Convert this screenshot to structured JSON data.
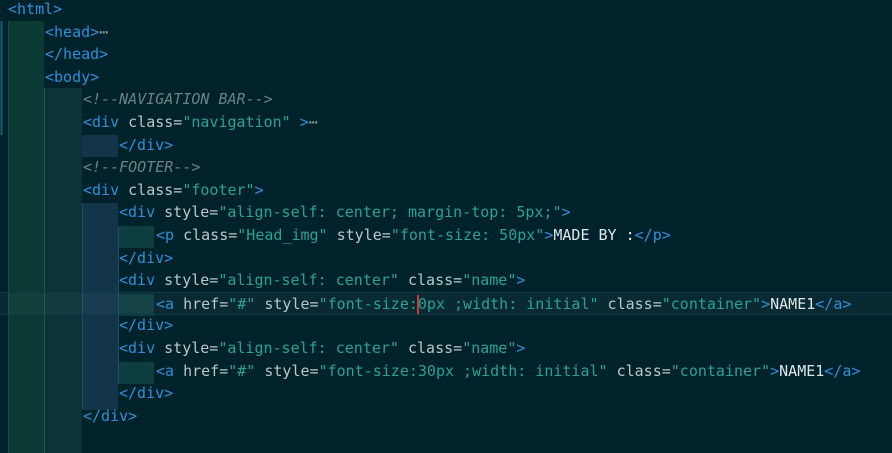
{
  "editor": {
    "colors": {
      "background": "#00232b",
      "tag": "#2d8fd8",
      "attribute": "#b9c7c7",
      "string": "#2aa198",
      "text": "#dde6e6",
      "comment": "#6c8184",
      "cursor": "#d0362f"
    },
    "lines": [
      {
        "indent": 0,
        "tokens": [
          {
            "t": "tag",
            "v": "<html>"
          }
        ]
      },
      {
        "indent": 1,
        "tokens": [
          {
            "t": "tag",
            "v": "<head>"
          },
          {
            "t": "fold",
            "v": "⋯"
          }
        ]
      },
      {
        "indent": 1,
        "tokens": [
          {
            "t": "tag",
            "v": "</head>"
          }
        ]
      },
      {
        "indent": 1,
        "tokens": [
          {
            "t": "tag",
            "v": "<body>"
          }
        ]
      },
      {
        "indent": 2,
        "tokens": [
          {
            "t": "cmt",
            "v": "<!--NAVIGATION BAR-->"
          }
        ]
      },
      {
        "indent": 2,
        "tokens": [
          {
            "t": "tag",
            "v": "<div"
          },
          {
            "t": "attr",
            "v": " class="
          },
          {
            "t": "str",
            "v": "\"navigation\""
          },
          {
            "t": "attr",
            "v": " "
          },
          {
            "t": "tag",
            "v": ">"
          },
          {
            "t": "fold",
            "v": "⋯"
          }
        ]
      },
      {
        "indent": 3,
        "tokens": [
          {
            "t": "tag",
            "v": "</div>"
          }
        ]
      },
      {
        "indent": 2,
        "tokens": [
          {
            "t": "cmt",
            "v": "<!--FOOTER-->"
          }
        ]
      },
      {
        "indent": 2,
        "tokens": [
          {
            "t": "tag",
            "v": "<div"
          },
          {
            "t": "attr",
            "v": " class="
          },
          {
            "t": "str",
            "v": "\"footer\""
          },
          {
            "t": "tag",
            "v": ">"
          }
        ]
      },
      {
        "indent": 3,
        "tokens": [
          {
            "t": "tag",
            "v": "<div"
          },
          {
            "t": "attr",
            "v": " style="
          },
          {
            "t": "str",
            "v": "\"align-self: center; margin-top: 5px;\""
          },
          {
            "t": "tag",
            "v": ">"
          }
        ]
      },
      {
        "indent": 4,
        "tokens": [
          {
            "t": "tag",
            "v": "<p"
          },
          {
            "t": "attr",
            "v": " class="
          },
          {
            "t": "str",
            "v": "\"Head_img\""
          },
          {
            "t": "attr",
            "v": " style="
          },
          {
            "t": "str",
            "v": "\"font-size: 50px\""
          },
          {
            "t": "tag",
            "v": ">"
          },
          {
            "t": "txt",
            "v": "MADE BY :"
          },
          {
            "t": "tag",
            "v": "</p>"
          }
        ]
      },
      {
        "indent": 3,
        "tokens": [
          {
            "t": "tag",
            "v": "</div>"
          }
        ]
      },
      {
        "indent": 3,
        "tokens": [
          {
            "t": "tag",
            "v": "<div"
          },
          {
            "t": "attr",
            "v": " style="
          },
          {
            "t": "str",
            "v": "\"align-self: center\""
          },
          {
            "t": "attr",
            "v": " class="
          },
          {
            "t": "str",
            "v": "\"name\""
          },
          {
            "t": "tag",
            "v": ">"
          }
        ]
      },
      {
        "indent": 4,
        "active": true,
        "tokens": [
          {
            "t": "tag",
            "v": "<a"
          },
          {
            "t": "attr",
            "v": " href="
          },
          {
            "t": "str",
            "v": "\"#\""
          },
          {
            "t": "attr",
            "v": " style="
          },
          {
            "t": "str",
            "v": "\"font-size:"
          },
          {
            "t": "cursor",
            "v": ""
          },
          {
            "t": "str",
            "v": "0px ;width: initial\""
          },
          {
            "t": "attr",
            "v": " class="
          },
          {
            "t": "str",
            "v": "\"container\""
          },
          {
            "t": "tag",
            "v": ">"
          },
          {
            "t": "txt",
            "v": "NAME1"
          },
          {
            "t": "tag",
            "v": "</a>"
          }
        ]
      },
      {
        "indent": 3,
        "tokens": [
          {
            "t": "tag",
            "v": "</div>"
          }
        ]
      },
      {
        "indent": 3,
        "tokens": [
          {
            "t": "tag",
            "v": "<div"
          },
          {
            "t": "attr",
            "v": " style="
          },
          {
            "t": "str",
            "v": "\"align-self: center\""
          },
          {
            "t": "attr",
            "v": " class="
          },
          {
            "t": "str",
            "v": "\"name\""
          },
          {
            "t": "tag",
            "v": ">"
          }
        ]
      },
      {
        "indent": 4,
        "tokens": [
          {
            "t": "tag",
            "v": "<a"
          },
          {
            "t": "attr",
            "v": " href="
          },
          {
            "t": "str",
            "v": "\"#\""
          },
          {
            "t": "attr",
            "v": " style="
          },
          {
            "t": "str",
            "v": "\"font-size:30px ;width: initial\""
          },
          {
            "t": "attr",
            "v": " class="
          },
          {
            "t": "str",
            "v": "\"container\""
          },
          {
            "t": "tag",
            "v": ">"
          },
          {
            "t": "txt",
            "v": "NAME1"
          },
          {
            "t": "tag",
            "v": "</a>"
          }
        ]
      },
      {
        "indent": 3,
        "tokens": [
          {
            "t": "tag",
            "v": "</div>"
          }
        ]
      },
      {
        "indent": 2,
        "tokens": [
          {
            "t": "tag",
            "v": "</div>"
          }
        ]
      }
    ]
  }
}
